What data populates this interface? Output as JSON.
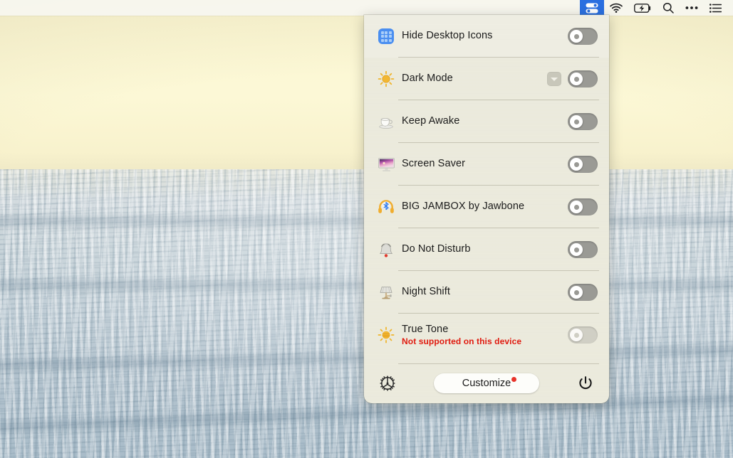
{
  "menubar": {
    "items": [
      {
        "name": "one-switch-icon",
        "label": "One Switch",
        "active": true
      },
      {
        "name": "wifi-icon",
        "label": "Wi-Fi",
        "active": false
      },
      {
        "name": "battery-charging-icon",
        "label": "Battery Charging",
        "active": false
      },
      {
        "name": "search-icon",
        "label": "Spotlight Search",
        "active": false
      },
      {
        "name": "control-center-icon",
        "label": "More",
        "active": false
      },
      {
        "name": "notification-center-icon",
        "label": "Notification Center",
        "active": false
      }
    ]
  },
  "panel": {
    "rows": [
      {
        "icon": "desktop-icons-grid-icon",
        "label": "Hide Desktop Icons",
        "sub": "",
        "toggle": "off",
        "has_chevron": false,
        "disabled": false
      },
      {
        "icon": "sun-icon",
        "label": "Dark Mode",
        "sub": "",
        "toggle": "off",
        "has_chevron": true,
        "disabled": false
      },
      {
        "icon": "coffee-cup-icon",
        "label": "Keep Awake",
        "sub": "",
        "toggle": "off",
        "has_chevron": false,
        "disabled": false
      },
      {
        "icon": "screen-saver-icon",
        "label": "Screen Saver",
        "sub": "",
        "toggle": "off",
        "has_chevron": false,
        "disabled": false
      },
      {
        "icon": "headphones-bluetooth-icon",
        "label": "BIG JAMBOX by Jawbone",
        "sub": "",
        "toggle": "off",
        "has_chevron": false,
        "disabled": false
      },
      {
        "icon": "bell-icon",
        "label": "Do Not Disturb",
        "sub": "",
        "toggle": "off",
        "has_chevron": false,
        "disabled": false
      },
      {
        "icon": "lamp-icon",
        "label": "Night Shift",
        "sub": "",
        "toggle": "off",
        "has_chevron": false,
        "disabled": false
      },
      {
        "icon": "sun-bright-icon",
        "label": "True Tone",
        "sub": "Not supported on this device",
        "toggle": "off",
        "has_chevron": false,
        "disabled": true
      }
    ],
    "footer": {
      "settings_label": "Settings",
      "settings_icon": "gear-icon",
      "customize_label": "Customize",
      "customize_badge": true,
      "power_label": "Quit",
      "power_icon": "power-icon"
    }
  },
  "colors": {
    "panel_bg": "#ecebdd",
    "accent_blue": "#2a6fe0",
    "warning_red": "#e01b0f",
    "toggle_off": "#9a9a95",
    "sky": "#fbf6d2",
    "sea": "#bdcbd4"
  }
}
